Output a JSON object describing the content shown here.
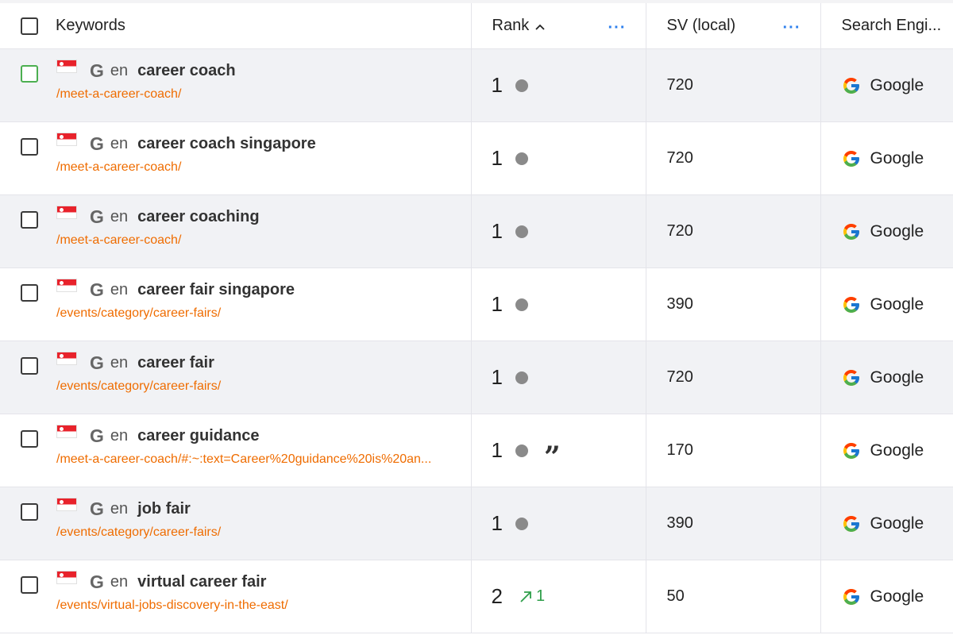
{
  "header": {
    "keywords": "Keywords",
    "rank": "Rank",
    "sv": "SV (local)",
    "engine": "Search Engi...",
    "more": "···"
  },
  "rows": [
    {
      "lang": "en",
      "keyword": "career coach",
      "url": "/meet-a-career-coach/",
      "rank": "1",
      "sv": "720",
      "engine": "Google",
      "checked_style": "green"
    },
    {
      "lang": "en",
      "keyword": "career coach singapore",
      "url": "/meet-a-career-coach/",
      "rank": "1",
      "sv": "720",
      "engine": "Google"
    },
    {
      "lang": "en",
      "keyword": "career coaching",
      "url": "/meet-a-career-coach/",
      "rank": "1",
      "sv": "720",
      "engine": "Google"
    },
    {
      "lang": "en",
      "keyword": "career fair singapore",
      "url": "/events/category/career-fairs/",
      "rank": "1",
      "sv": "390",
      "engine": "Google"
    },
    {
      "lang": "en",
      "keyword": "career fair",
      "url": "/events/category/career-fairs/",
      "rank": "1",
      "sv": "720",
      "engine": "Google"
    },
    {
      "lang": "en",
      "keyword": "career guidance",
      "url": "/meet-a-career-coach/#:~:text=Career%20guidance%20is%20an...",
      "rank": "1",
      "sv": "170",
      "engine": "Google",
      "feature": "”"
    },
    {
      "lang": "en",
      "keyword": "job fair",
      "url": "/events/category/career-fairs/",
      "rank": "1",
      "sv": "390",
      "engine": "Google"
    },
    {
      "lang": "en",
      "keyword": "virtual career fair",
      "url": "/events/virtual-jobs-discovery-in-the-east/",
      "rank": "2",
      "sv": "50",
      "engine": "Google",
      "change": "1"
    }
  ],
  "icons": {
    "flag": "singapore-flag-icon",
    "engine_mono": "G",
    "sort": "chevron-up-icon",
    "change": "arrow-up-right-icon",
    "quote": "featured-snippet-quote-icon"
  },
  "colors": {
    "url": "#ef6c00",
    "accent": "#2f80ed",
    "up": "#2e9e4a",
    "row_alt": "#f1f2f5"
  }
}
